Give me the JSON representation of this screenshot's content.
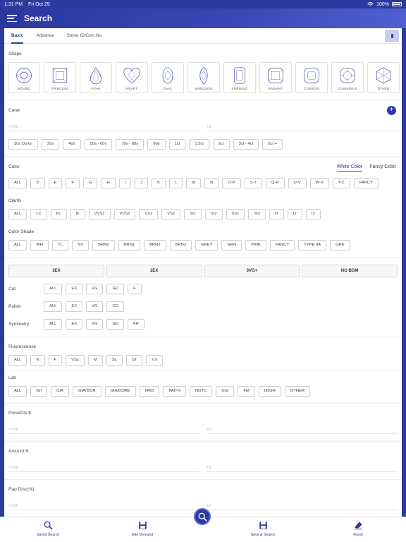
{
  "status": {
    "time": "1:31 PM",
    "date": "Fri Oct 25",
    "battery": "100%"
  },
  "header": {
    "title": "Search"
  },
  "tabs": [
    {
      "label": "Basic",
      "active": true
    },
    {
      "label": "Advance",
      "active": false
    },
    {
      "label": "Stone ID/Cert No",
      "active": false
    }
  ],
  "shape": {
    "label": "Shape",
    "items": [
      "ROUND",
      "PRINCESS",
      "PEAR",
      "HEART",
      "OVAL",
      "MARQUISE",
      "EMERALD",
      "RADIANT",
      "CUSHION",
      "CUSHION B",
      "OTHER"
    ]
  },
  "carat": {
    "label": "Carat",
    "from_placeholder": "From",
    "to_placeholder": "To",
    "add_label": "+",
    "presets": [
      "30s Down",
      "30s",
      "40s",
      "50s - 60s",
      "70s - 80s",
      "90s",
      "1ct",
      "1.5ct",
      "2ct",
      "3ct - 4ct",
      "5ct +"
    ]
  },
  "color": {
    "label": "Color",
    "toggle": [
      "White Color",
      "Fancy Color"
    ],
    "options": [
      "ALL",
      "D",
      "E",
      "F",
      "G",
      "H",
      "I",
      "J",
      "K",
      "L",
      "M",
      "N",
      "O-P",
      "S-T",
      "Q-R",
      "U-V",
      "W-X",
      "Y-Z",
      "FANCY"
    ]
  },
  "clarity": {
    "label": "Clarity",
    "options": [
      "ALL",
      "LC",
      "FL",
      "IF",
      "VVS1",
      "VVS2",
      "VS1",
      "VS2",
      "SI1",
      "SI2",
      "SI2-",
      "SI3",
      "I1",
      "I2",
      "I3"
    ]
  },
  "shade": {
    "label": "Color Shade",
    "options": [
      "ALL",
      "WH",
      "YL",
      "NV",
      "BRN0",
      "BRN1",
      "BRN2",
      "BRN3",
      "GREY",
      "GRN",
      "PINK",
      "FANCY",
      "TYPE IIA",
      "GRE"
    ]
  },
  "combos": [
    "3EX",
    "2EX",
    "3VG+",
    "NO BGM"
  ],
  "cut": {
    "label": "Cut",
    "options": [
      "ALL",
      "EX",
      "VG",
      "GD",
      "F"
    ]
  },
  "polish": {
    "label": "Polish",
    "options": [
      "ALL",
      "EX",
      "VG",
      "GD"
    ]
  },
  "symmetry": {
    "label": "Symmetry",
    "options": [
      "ALL",
      "EX",
      "VG",
      "GD",
      "FR"
    ]
  },
  "fluorescence": {
    "label": "Fluorescense",
    "options": [
      "ALL",
      "N",
      "F",
      "VSL",
      "M",
      "SL",
      "ST",
      "VS"
    ]
  },
  "lab": {
    "label": "Lab",
    "options": [
      "ALL",
      "IGI",
      "GIA",
      "GIA/DOR",
      "GIA/DORE",
      "HRD",
      "FAITH",
      "NGTC",
      "GSI",
      "FM",
      "IIDGR",
      "OTHER"
    ]
  },
  "price": {
    "label": "Price/Cts $",
    "from_placeholder": "From",
    "to_placeholder": "To"
  },
  "amount": {
    "label": "Amount $",
    "from_placeholder": "From",
    "to_placeholder": "To"
  },
  "rap": {
    "label": "Rap Disc(%)",
    "from_placeholder": "From",
    "to_placeholder": "To"
  },
  "bottom": {
    "saved_search": "Saved Search",
    "add_demand": "Add Demand",
    "save_search": "Save & Search",
    "reset": "Reset"
  },
  "colors": {
    "primary": "#2c3a9e",
    "accent": "#c8cdf0"
  }
}
